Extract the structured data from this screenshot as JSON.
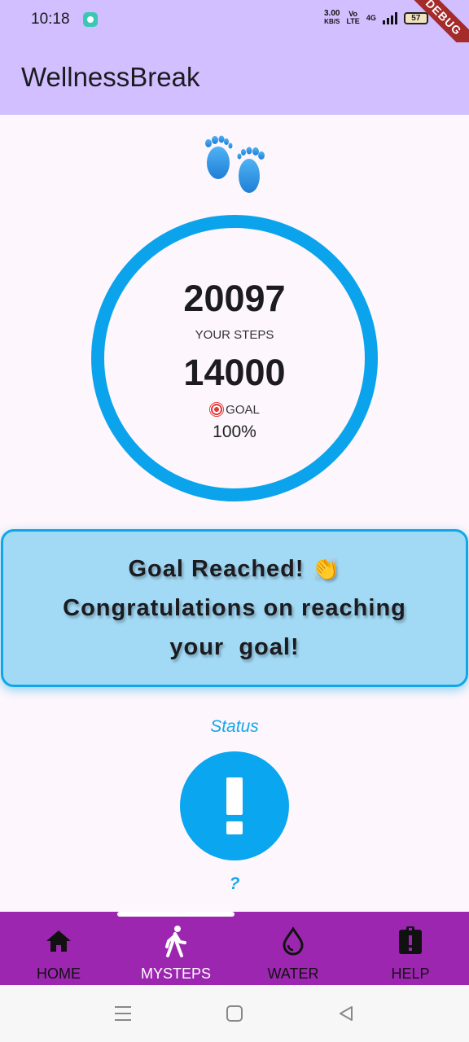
{
  "status_bar": {
    "time": "10:18",
    "net_speed": "3.00",
    "net_unit": "KB/S",
    "volte_top": "Vo",
    "volte_bottom": "LTE",
    "network": "4G",
    "battery": "57",
    "debug_label": "DEBUG"
  },
  "app_bar": {
    "title": "WellnessBreak"
  },
  "progress": {
    "steps": "20097",
    "steps_label": "YOUR STEPS",
    "goal": "14000",
    "goal_label": "GOAL",
    "percent_text": "100%",
    "ring_fraction": 1.0,
    "ring_color": "#0ba4ec"
  },
  "congrats": {
    "line1": "Goal Reached!",
    "line1_emoji": "👏",
    "line2": "Congratulations on reaching",
    "line3": "your  goal!",
    "card_color": "#a2daf6"
  },
  "status_section": {
    "heading": "Status",
    "value": "?",
    "icon": "exclamation-icon",
    "color": "#0aa6ef"
  },
  "bottom_nav": {
    "color": "#9c26b0",
    "items": [
      {
        "label": "HOME",
        "icon": "home-icon"
      },
      {
        "label": "MYSTEPS",
        "icon": "walk-icon"
      },
      {
        "label": "WATER",
        "icon": "water-drop-icon"
      },
      {
        "label": "HELP",
        "icon": "help-clipboard-icon"
      }
    ],
    "active_index": 1
  },
  "system_nav": {
    "buttons": [
      "menu-icon",
      "home-square-icon",
      "back-icon"
    ]
  }
}
